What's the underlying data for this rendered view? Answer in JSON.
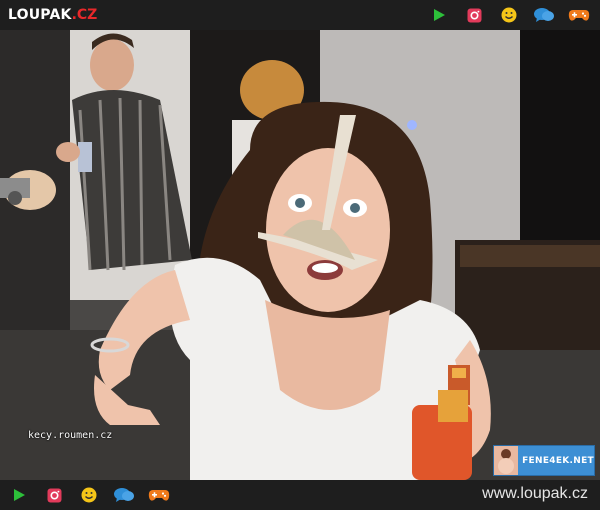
{
  "header": {
    "logo_name": "LOUPAK",
    "logo_tld": ".CZ",
    "icons": [
      "play-icon",
      "instagram-icon",
      "smiley-icon",
      "chat-icon",
      "gamepad-icon"
    ]
  },
  "photo": {
    "watermark": "kecy.roumen.cz",
    "badge_label": "FENE4EK.NET"
  },
  "footer": {
    "url": "www.loupak.cz",
    "icons": [
      "play-icon",
      "instagram-icon",
      "smiley-icon",
      "chat-icon",
      "gamepad-icon"
    ]
  },
  "colors": {
    "bar_bg": "#1e1e1e",
    "play": "#2dbf3a",
    "instagram": "#e23b5b",
    "smiley": "#f5c518",
    "chat": "#2f8fd8",
    "gamepad": "#f07a1a",
    "brand_red": "#e8282a"
  }
}
